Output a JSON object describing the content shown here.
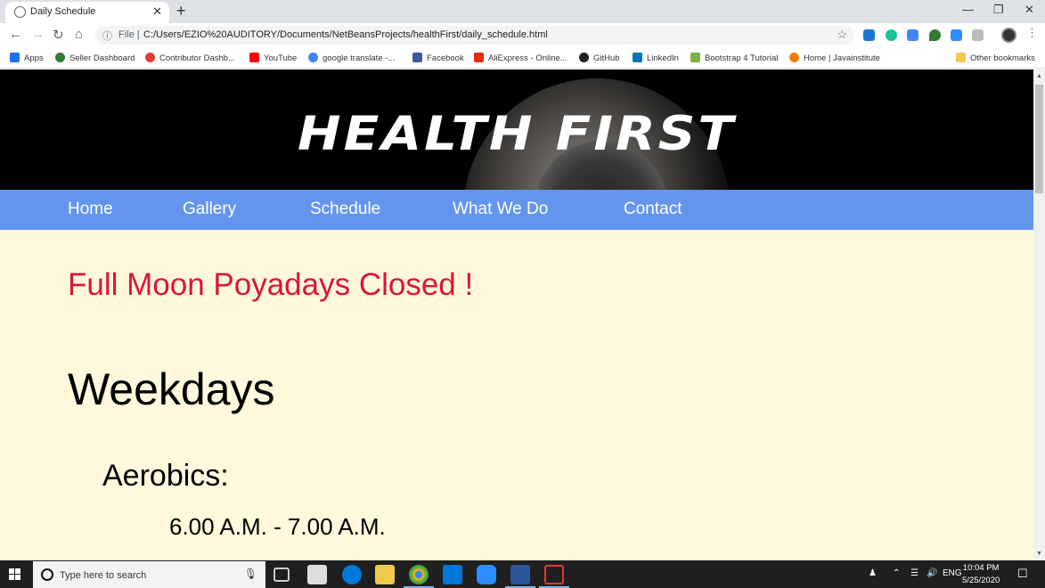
{
  "browser": {
    "tab_title": "Daily Schedule",
    "new_tab": "+",
    "tab_close": "✕",
    "file_label": "File |",
    "url": "C:/Users/EZIO%20AUDITORY/Documents/NetBeansProjects/healthFirst/daily_schedule.html",
    "bookmarks": [
      {
        "label": "Apps",
        "color": "#1a73e8"
      },
      {
        "label": "Seller Dashboard",
        "color": "#2e7d32"
      },
      {
        "label": "Contributor Dashb...",
        "color": "#e53935"
      },
      {
        "label": "YouTube",
        "color": "#ff0000"
      },
      {
        "label": "google translate -...",
        "color": "#4285f4"
      },
      {
        "label": "Facebook",
        "color": "#3b5998"
      },
      {
        "label": "AliExpress - Online...",
        "color": "#e62e04"
      },
      {
        "label": "GitHub",
        "color": "#222222"
      },
      {
        "label": "LinkedIn",
        "color": "#0077b5"
      },
      {
        "label": "Bootstrap 4 Tutorial",
        "color": "#7cb342"
      },
      {
        "label": "Home | Javainstitute",
        "color": "#f57c00"
      },
      {
        "label": "Other bookmarks",
        "color": "#f2c94c"
      }
    ]
  },
  "site": {
    "logo_text": "HEALTH FIRST",
    "nav": [
      "Home",
      "Gallery",
      "Schedule",
      "What We Do",
      "Contact"
    ],
    "notice": "Full Moon Poyadays Closed !",
    "section_heading": "Weekdays",
    "class_name": "Aerobics:",
    "class_time": "6.00 A.M. - 7.00 A.M."
  },
  "taskbar": {
    "search_placeholder": "Type here to search",
    "language": "ENG",
    "time": "10:04 PM",
    "date": "5/25/2020"
  },
  "colors": {
    "nav_bg": "#6495ed",
    "page_bg": "#fff8dc",
    "notice": "#dc143c"
  }
}
